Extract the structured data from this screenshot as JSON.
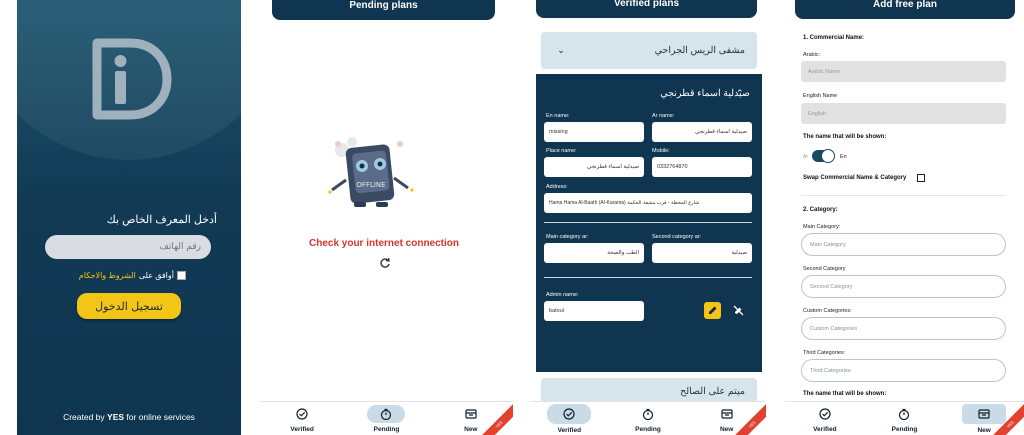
{
  "login": {
    "prompt": "أدخل المعرف الخاص بك",
    "phone_placeholder": "رقم الهاتف",
    "agree": "أوافق على",
    "terms_link": "الشروط والاحكام",
    "login_button": "تسجيل الدخول",
    "credit_prefix": "Created by",
    "credit_brand": "YES",
    "credit_suffix": "for online services",
    "logo_icon": "id-logo-icon"
  },
  "pending": {
    "header": "Pending plans",
    "illustration_text": "OFFLINE",
    "message": "Check your internet connection",
    "retry_icon": "refresh-icon"
  },
  "verified": {
    "header": "Verified plans",
    "items": [
      {
        "name": "مشفى الريس الجراحي"
      },
      {
        "name": "صيدلية اسماء قطرنجي"
      },
      {
        "name": "ميتم على الصالح"
      }
    ],
    "detail": {
      "en_name_label": "En name:",
      "en_name_value": "missing",
      "ar_name_label": "Ar name:",
      "ar_name_value": "صيدلية اسماء قطرنجي",
      "place_name_label": "Place name:",
      "place_name_value": "صيدلية اسماء قطرنجي",
      "mobile_label": "Mobile:",
      "mobile_value": "0332764870",
      "address_label": "Address:",
      "address_value": "Hama  Hama  Al-Baath (Al-Karama)  شارع المحطة - قرب مشفة الحكمة",
      "main_category_label": "Main category ar:",
      "main_category_value": "الطب والصحة",
      "second_category_label": "Second category ar:",
      "second_category_value": "صيدلية",
      "admin_label": "Admin name:",
      "admin_value": "batoul"
    }
  },
  "add_plan": {
    "header": "Add free plan",
    "section1": "1. Commercial Name:",
    "arabic_label": "Arabic:",
    "arabic_placeholder": "Arabic Name",
    "english_label": "English Name",
    "english_placeholder": "English",
    "shown_label": "The name that will be shown:",
    "toggle_ar": "Ar",
    "toggle_en": "En",
    "swap_label": "Swap Commercial Name & Category",
    "section2": "2. Category:",
    "main_category_label": "Main Category:",
    "main_category_placeholder": "Main Category",
    "second_category_label": "Second Category",
    "second_category_placeholder": "Second Category",
    "custom_categories_label": "Custom Categories:",
    "custom_categories_placeholder": "Custom Categories",
    "third_categories_label": "Third Categories:",
    "third_categories_placeholder": "Third Categories",
    "shown_label_2": "The name that will be shown:"
  },
  "nav": {
    "verified": "Verified",
    "pending": "Pending",
    "new": "New",
    "ribbon": "YES"
  },
  "colors": {
    "primary": "#0f3551",
    "accent": "#f3c516",
    "error": "#d8342a",
    "ribbon": "#e0422f"
  }
}
